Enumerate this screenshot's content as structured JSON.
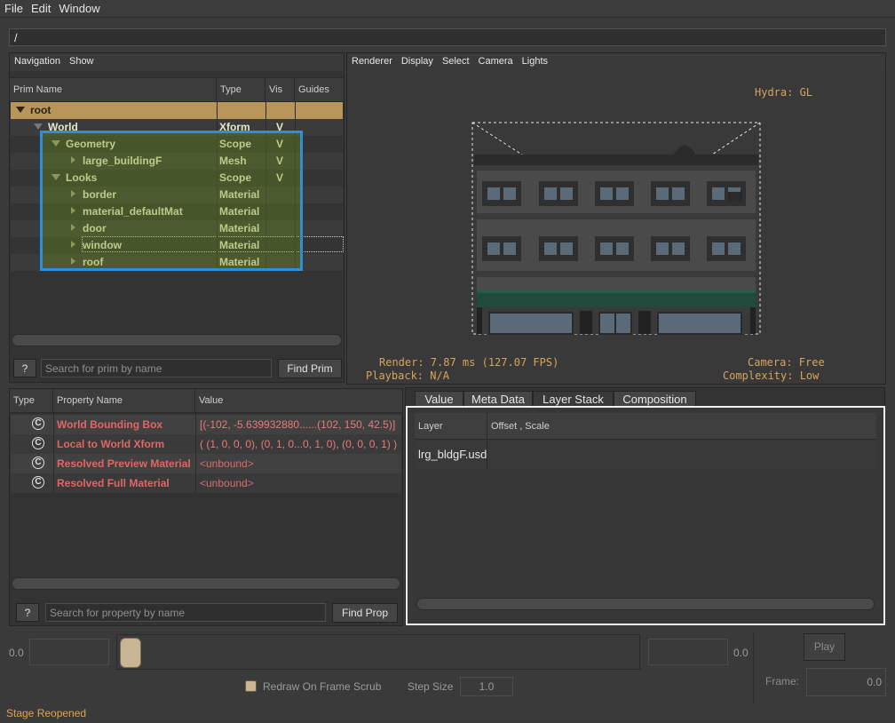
{
  "menubar": {
    "file": "File",
    "edit": "Edit",
    "window": "Window"
  },
  "path": "/",
  "prim_panel": {
    "menu": {
      "navigation": "Navigation",
      "show": "Show"
    },
    "headers": {
      "name": "Prim Name",
      "type": "Type",
      "vis": "Vis",
      "guides": "Guides"
    },
    "rows": [
      {
        "name": "root",
        "type": "",
        "vis": ""
      },
      {
        "name": "World",
        "type": "Xform",
        "vis": "V"
      },
      {
        "name": "Geometry",
        "type": "Scope",
        "vis": "V"
      },
      {
        "name": "large_buildingF",
        "type": "Mesh",
        "vis": "V"
      },
      {
        "name": "Looks",
        "type": "Scope",
        "vis": "V"
      },
      {
        "name": "border",
        "type": "Material",
        "vis": ""
      },
      {
        "name": "material_defaultMat",
        "type": "Material",
        "vis": ""
      },
      {
        "name": "door",
        "type": "Material",
        "vis": ""
      },
      {
        "name": "window",
        "type": "Material",
        "vis": ""
      },
      {
        "name": "roof",
        "type": "Material",
        "vis": ""
      }
    ],
    "help_label": "?",
    "search_placeholder": "Search for prim by name",
    "find_label": "Find Prim"
  },
  "viewport": {
    "menu": {
      "renderer": "Renderer",
      "display": "Display",
      "select": "Select",
      "camera": "Camera",
      "lights": "Lights"
    },
    "hydra": "Hydra: GL",
    "render": "Render: 7.87 ms (127.07 FPS)",
    "playback": "Playback: N/A",
    "camera": "Camera: Free",
    "complexity": "Complexity: Low"
  },
  "property_panel": {
    "headers": {
      "type": "Type",
      "name": "Property Name",
      "value": "Value"
    },
    "rows": [
      {
        "icon": "C",
        "name": "World Bounding Box",
        "value": "[(-102, -5.639932880......(102, 150, 42.5)]"
      },
      {
        "icon": "C",
        "name": "Local to World Xform",
        "value": "( (1, 0, 0, 0), (0, 1, 0...0, 1, 0), (0, 0, 0, 1) )"
      },
      {
        "icon": "C",
        "name": "Resolved Preview Material",
        "value": "<unbound>"
      },
      {
        "icon": "C",
        "name": "Resolved Full Material",
        "value": "<unbound>"
      }
    ],
    "help_label": "?",
    "search_placeholder": "Search for property by name",
    "find_label": "Find Prop"
  },
  "layer_panel": {
    "tabs": [
      "Value",
      "Meta Data",
      "Layer Stack",
      "Composition"
    ],
    "active_tab": "Layer Stack",
    "headers": {
      "layer": "Layer",
      "offset": "Offset , Scale"
    },
    "rows": [
      {
        "layer": "lrg_bldgF.usd",
        "offset": ""
      }
    ]
  },
  "timeline": {
    "start_label": "0.0",
    "end_label": "0.0",
    "play_label": "Play",
    "frame_label": "Frame:",
    "frame_value": "0.0",
    "redraw_label": "Redraw On Frame Scrub",
    "step_label": "Step Size",
    "step_value": "1.0"
  },
  "status": "Stage Reopened"
}
